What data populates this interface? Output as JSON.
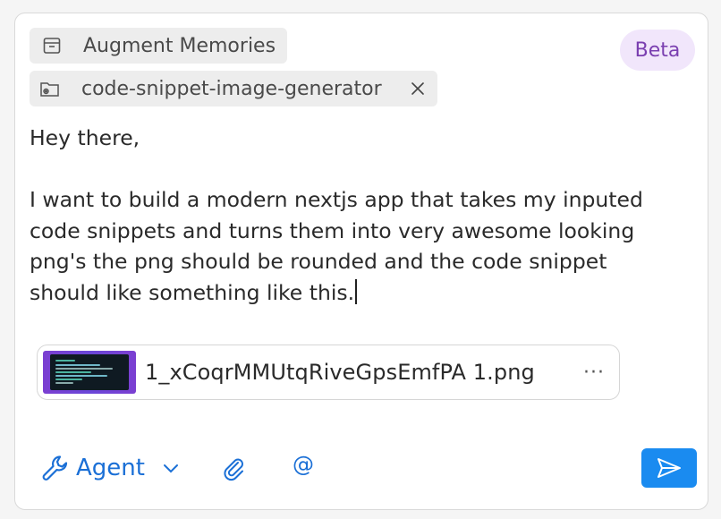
{
  "chips": {
    "memories": {
      "label": "Augment Memories",
      "icon": "archive-box-icon"
    },
    "project": {
      "label": "code-snippet-image-generator",
      "icon": "folder-icon"
    }
  },
  "badge": {
    "label": "Beta"
  },
  "message": {
    "greeting": "Hey there,",
    "body": "I want to build a modern nextjs app that takes my inputed code snippets and turns them into very awesome looking png's the png should be rounded and the code snippet should like something like this."
  },
  "attachment": {
    "filename": "1_xCoqrMMUtqRiveGpsEmfPA 1.png",
    "more": "···"
  },
  "toolbar": {
    "mode_label": "Agent",
    "mention_label": "@"
  },
  "colors": {
    "accent": "#1a6fd6",
    "send": "#1a8bf0",
    "beta_bg": "#f1e6fb",
    "beta_text": "#7a3fb0"
  }
}
